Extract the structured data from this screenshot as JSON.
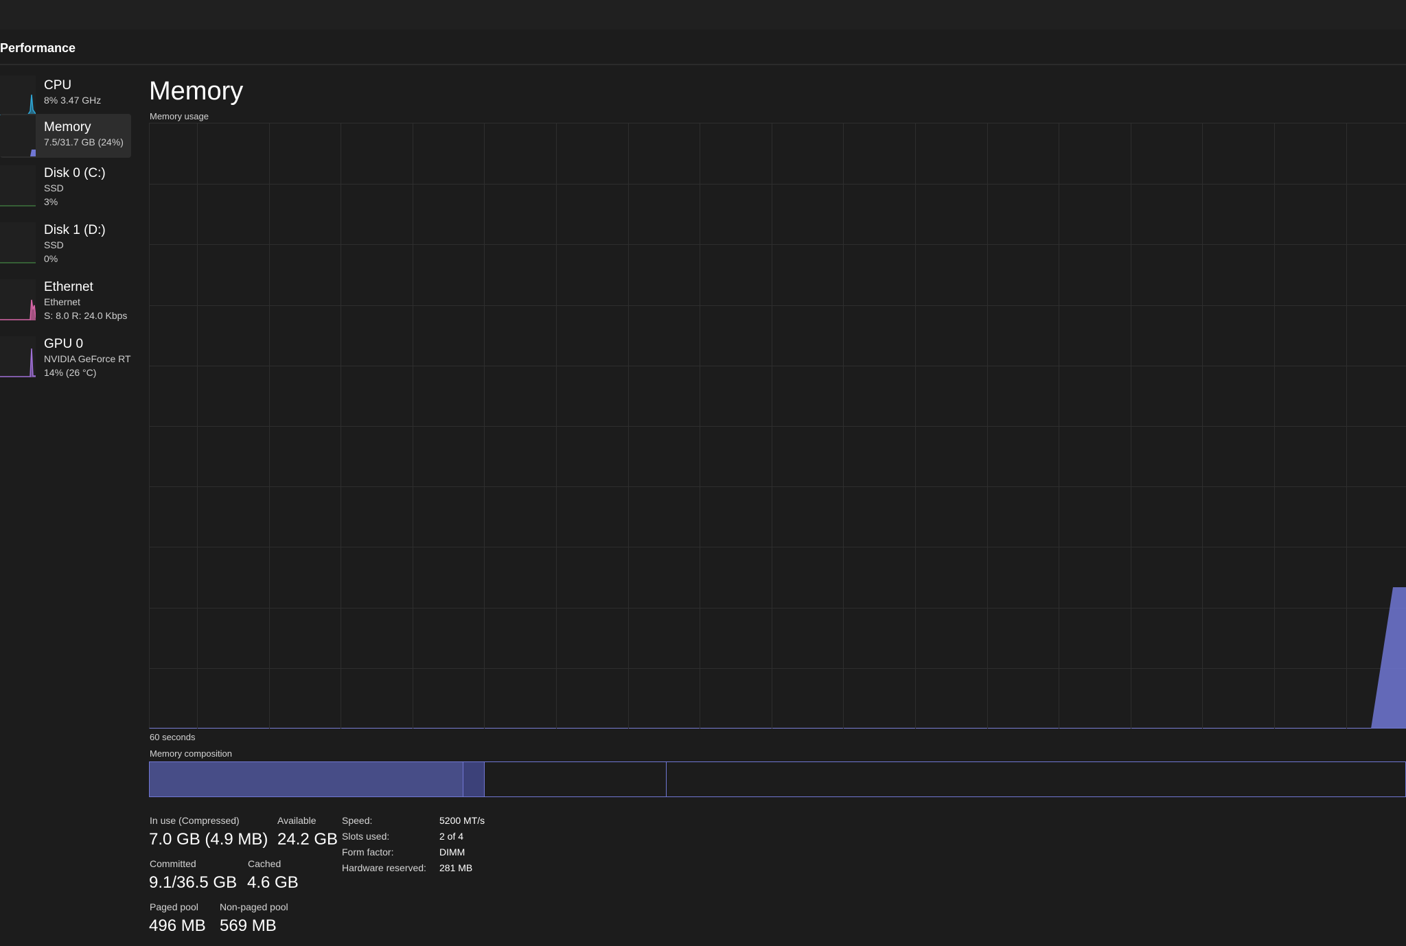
{
  "header": {
    "title": "Performance"
  },
  "sidebar": {
    "items": [
      {
        "name": "CPU",
        "lines": [
          "8% 3.47 GHz"
        ],
        "color": "#2ea8d8"
      },
      {
        "name": "Memory",
        "lines": [
          "7.5/31.7 GB (24%)"
        ],
        "color": "#7077d4"
      },
      {
        "name": "Disk 0 (C:)",
        "lines": [
          "SSD",
          "3%"
        ],
        "color": "#4aa04a"
      },
      {
        "name": "Disk 1 (D:)",
        "lines": [
          "SSD",
          "0%"
        ],
        "color": "#4aa04a"
      },
      {
        "name": "Ethernet",
        "lines": [
          "Ethernet",
          "S: 8.0 R: 24.0 Kbps"
        ],
        "color": "#d866a8"
      },
      {
        "name": "GPU 0",
        "lines": [
          "NVIDIA GeForce RT",
          "14% (26 °C)"
        ],
        "color": "#a070d8"
      }
    ]
  },
  "main": {
    "title": "Memory",
    "usage_label": "Memory usage",
    "time_label": "60 seconds",
    "composition_label": "Memory composition",
    "accent_color": "#7077d4"
  },
  "stats": {
    "in_use_label": "In use (Compressed)",
    "in_use_value": "7.0 GB (4.9 MB)",
    "available_label": "Available",
    "available_value": "24.2 GB",
    "committed_label": "Committed",
    "committed_value": "9.1/36.5 GB",
    "cached_label": "Cached",
    "cached_value": "4.6 GB",
    "paged_pool_label": "Paged pool",
    "paged_pool_value": "496 MB",
    "nonpaged_pool_label": "Non-paged pool",
    "nonpaged_pool_value": "569 MB"
  },
  "info": {
    "speed_label": "Speed:",
    "speed_value": "5200 MT/s",
    "slots_label": "Slots used:",
    "slots_value": "2 of 4",
    "form_label": "Form factor:",
    "form_value": "DIMM",
    "reserved_label": "Hardware reserved:",
    "reserved_value": "281 MB"
  }
}
